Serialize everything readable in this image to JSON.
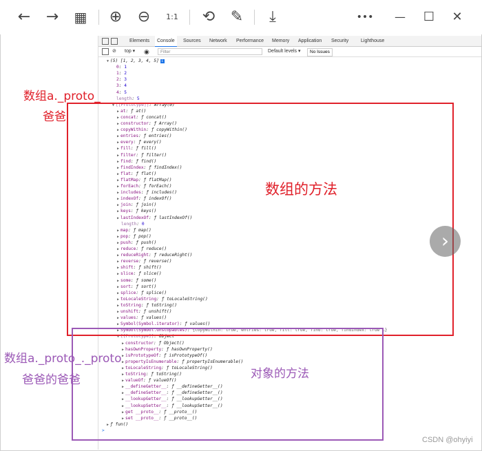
{
  "toolbar": {
    "icons": [
      "back-icon",
      "forward-icon",
      "grid-icon",
      "zoom-in-icon",
      "zoom-out-icon",
      "actual-size-icon",
      "rotate-icon",
      "edit-icon",
      "download-icon",
      "more-icon",
      "minimize-icon",
      "maximize-icon",
      "close-icon"
    ],
    "glyphs": {
      "back": "←",
      "forward": "→",
      "grid": "▦",
      "zoom_in": "⊕",
      "zoom_out": "⊖",
      "actual": "1:1",
      "rotate": "⟲",
      "edit": "✎",
      "download": "⤓",
      "more": "•••",
      "minimize": "—",
      "maximize": "☐",
      "close": "✕"
    }
  },
  "devtools": {
    "tabs": [
      "Elements",
      "Console",
      "Sources",
      "Network",
      "Performance",
      "Memory",
      "Application",
      "Security",
      "Lighthouse"
    ],
    "active_tab": "Console",
    "context": "top ▾",
    "filter_placeholder": "Filter",
    "levels": "Default levels ▾",
    "issues": "No Issues"
  },
  "console": {
    "header": "(5) [1, 2, 3, 4, 5]",
    "indices": [
      "0: 1",
      "1: 2",
      "2: 3",
      "3: 4",
      "4: 5"
    ],
    "length": "length: 5",
    "proto1": "[[Prototype]]: Array(0)",
    "array_methods": [
      [
        "at",
        "ƒ at()"
      ],
      [
        "concat",
        "ƒ concat()"
      ],
      [
        "constructor",
        "ƒ Array()"
      ],
      [
        "copyWithin",
        "ƒ copyWithin()"
      ],
      [
        "entries",
        "ƒ entries()"
      ],
      [
        "every",
        "ƒ every()"
      ],
      [
        "fill",
        "ƒ fill()"
      ],
      [
        "filter",
        "ƒ filter()"
      ],
      [
        "find",
        "ƒ find()"
      ],
      [
        "findIndex",
        "ƒ findIndex()"
      ],
      [
        "flat",
        "ƒ flat()"
      ],
      [
        "flatMap",
        "ƒ flatMap()"
      ],
      [
        "forEach",
        "ƒ forEach()"
      ],
      [
        "includes",
        "ƒ includes()"
      ],
      [
        "indexOf",
        "ƒ indexOf()"
      ],
      [
        "join",
        "ƒ join()"
      ],
      [
        "keys",
        "ƒ keys()"
      ],
      [
        "lastIndexOf",
        "ƒ lastIndexOf()"
      ]
    ],
    "length0": "length: 0",
    "array_methods2": [
      [
        "map",
        "ƒ map()"
      ],
      [
        "pop",
        "ƒ pop()"
      ],
      [
        "push",
        "ƒ push()"
      ],
      [
        "reduce",
        "ƒ reduce()"
      ],
      [
        "reduceRight",
        "ƒ reduceRight()"
      ],
      [
        "reverse",
        "ƒ reverse()"
      ],
      [
        "shift",
        "ƒ shift()"
      ],
      [
        "slice",
        "ƒ slice()"
      ],
      [
        "some",
        "ƒ some()"
      ],
      [
        "sort",
        "ƒ sort()"
      ],
      [
        "splice",
        "ƒ splice()"
      ],
      [
        "toLocaleString",
        "ƒ toLocaleString()"
      ],
      [
        "toString",
        "ƒ toString()"
      ],
      [
        "unshift",
        "ƒ unshift()"
      ],
      [
        "values",
        "ƒ values()"
      ],
      [
        "Symbol(Symbol.iterator)",
        "ƒ values()"
      ]
    ],
    "unscopables": "Symbol(Symbol.unscopables): {copyWithin: true, entries: true, fill: true, find: true, findIndex: true …}",
    "proto2": "[[Prototype]]: Object",
    "object_methods": [
      [
        "constructor",
        "ƒ Object()"
      ],
      [
        "hasOwnProperty",
        "ƒ hasOwnProperty()"
      ],
      [
        "isPrototypeOf",
        "ƒ isPrototypeOf()"
      ],
      [
        "propertyIsEnumerable",
        "ƒ propertyIsEnumerable()"
      ],
      [
        "toLocaleString",
        "ƒ toLocaleString()"
      ],
      [
        "toString",
        "ƒ toString()"
      ],
      [
        "valueOf",
        "ƒ valueOf()"
      ],
      [
        "__defineGetter__",
        "ƒ __defineGetter__()"
      ],
      [
        "__defineSetter__",
        "ƒ __defineSetter__()"
      ],
      [
        "__lookupGetter__",
        "ƒ __lookupGetter__()"
      ],
      [
        "__lookupSetter__",
        "ƒ __lookupSetter__()"
      ],
      [
        "get __proto__",
        "ƒ __proto__()"
      ],
      [
        "set __proto__",
        "ƒ __proto__()"
      ]
    ],
    "fun": "ƒ fun()",
    "prompt": ">"
  },
  "annotations": {
    "proto_label": "数组a._proto_",
    "proto_sub": "爸爸",
    "array_methods_label": "数组的方法",
    "proto_proto_label": "数组a._proto_._proto",
    "proto_proto_sub": "爸爸的爸爸",
    "object_methods_label": "对象的方法",
    "red": "#e0202a",
    "purple": "#9b59b6"
  },
  "nav_next": "›",
  "watermark": "CSDN @ohyiyi"
}
